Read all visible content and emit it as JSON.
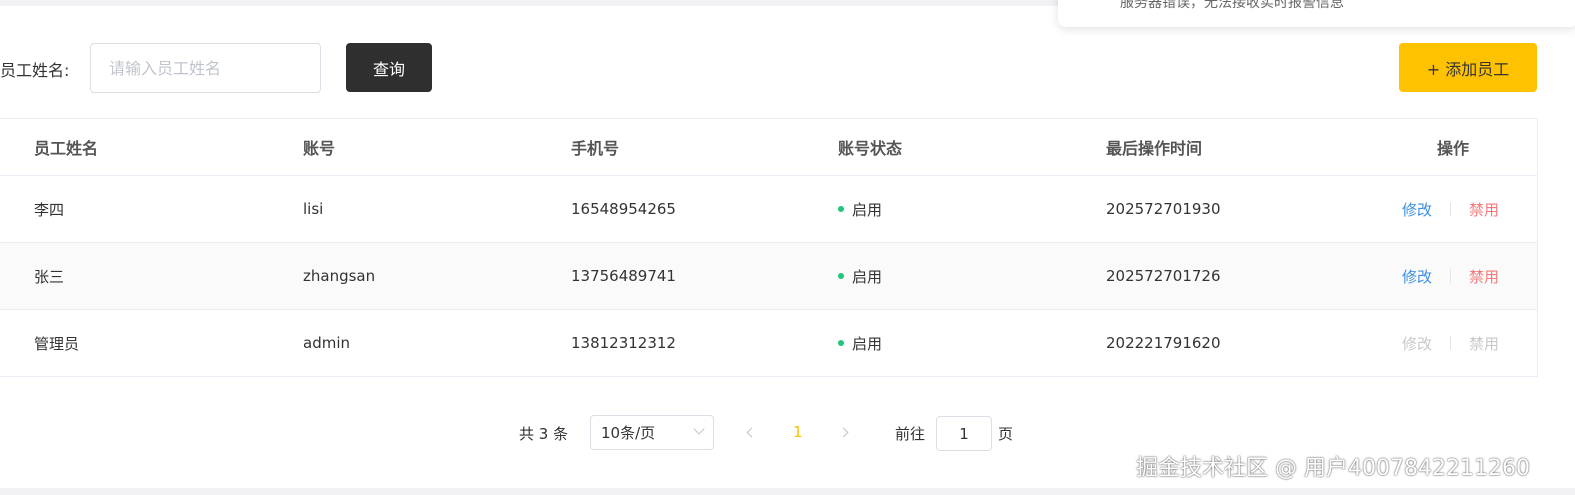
{
  "toast": {
    "message": "服务器错误，无法接收实时报警信息"
  },
  "search": {
    "label": "员工姓名:",
    "placeholder": "请输入员工姓名",
    "query_label": "查询"
  },
  "add_button_label": "+ 添加员工",
  "table": {
    "columns": [
      "员工姓名",
      "账号",
      "手机号",
      "账号状态",
      "最后操作时间",
      "操作"
    ],
    "rows": [
      {
        "name": "李四",
        "account": "lisi",
        "phone": "16548954265",
        "status": "启用",
        "last_time": "202572701930",
        "edit": "修改",
        "disable": "禁用"
      },
      {
        "name": "张三",
        "account": "zhangsan",
        "phone": "13756489741",
        "status": "启用",
        "last_time": "202572701726",
        "edit": "修改",
        "disable": "禁用"
      },
      {
        "name": "管理员",
        "account": "admin",
        "phone": "13812312312",
        "status": "启用",
        "last_time": "202221791620",
        "edit": "修改",
        "disable": "禁用"
      }
    ]
  },
  "pagination": {
    "total_text": "共 3 条",
    "page_size": "10条/页",
    "current_page": "1",
    "goto_prefix": "前往",
    "goto_value": "1",
    "goto_suffix": "页"
  },
  "watermark": "掘金技术社区 @ 用户4007842211260",
  "colors": {
    "accent": "#ffc200",
    "query_button": "#2f2f2f",
    "status_active": "#1fc67a",
    "edit_link": "#3d8fe0",
    "disable_link": "#f3797a",
    "disabled_action": "#c8c8c8"
  }
}
